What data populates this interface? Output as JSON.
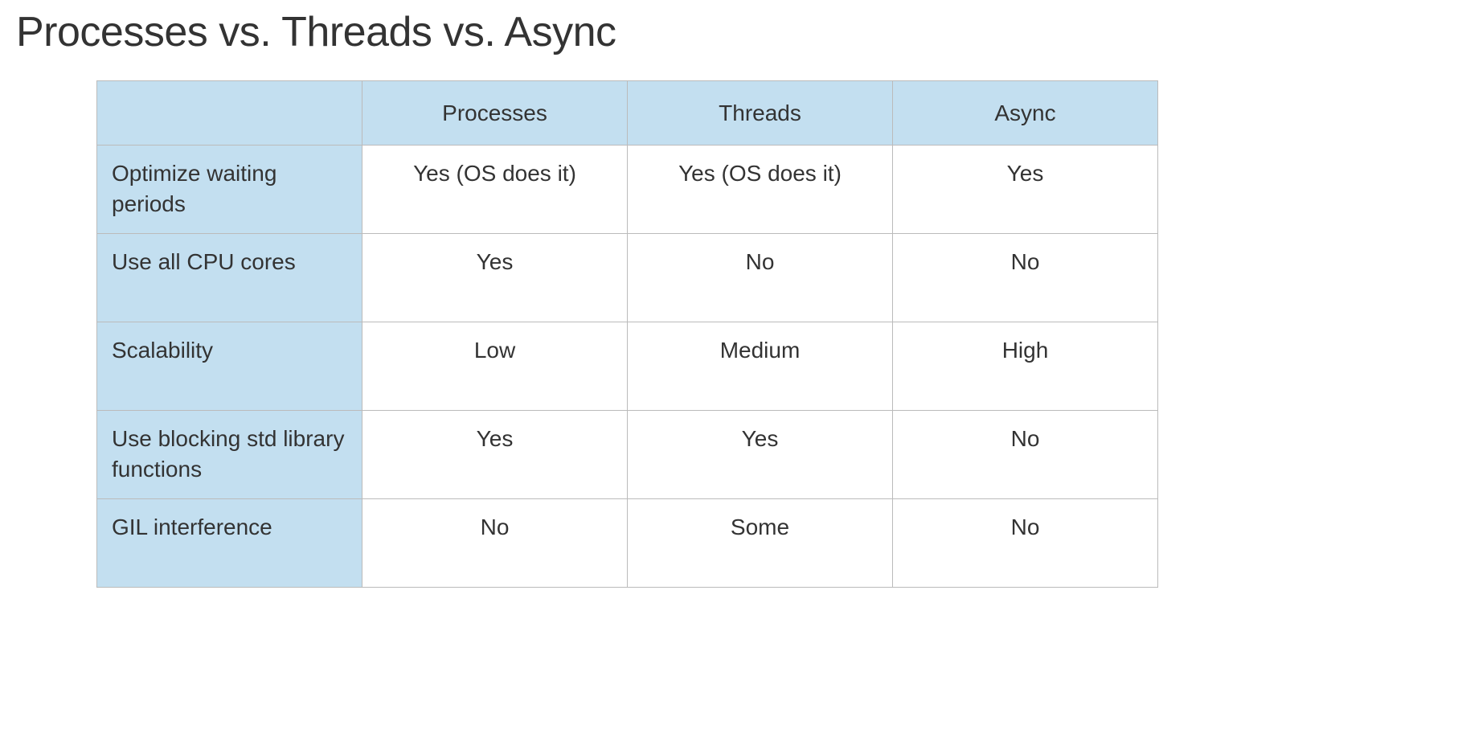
{
  "title": "Processes vs. Threads vs. Async",
  "columns": [
    "Processes",
    "Threads",
    "Async"
  ],
  "rows": [
    {
      "label": "Optimize waiting periods",
      "cells": [
        "Yes (OS does it)",
        "Yes (OS does it)",
        "Yes"
      ]
    },
    {
      "label": "Use all CPU cores",
      "cells": [
        "Yes",
        "No",
        "No"
      ]
    },
    {
      "label": "Scalability",
      "cells": [
        "Low",
        "Medium",
        "High"
      ]
    },
    {
      "label": "Use blocking std library functions",
      "cells": [
        "Yes",
        "Yes",
        "No"
      ]
    },
    {
      "label": "GIL interference",
      "cells": [
        "No",
        "Some",
        "No"
      ]
    }
  ],
  "chart_data": {
    "type": "table",
    "title": "Processes vs. Threads vs. Async",
    "columns": [
      "",
      "Processes",
      "Threads",
      "Async"
    ],
    "rows": [
      [
        "Optimize waiting periods",
        "Yes (OS does it)",
        "Yes (OS does it)",
        "Yes"
      ],
      [
        "Use all CPU cores",
        "Yes",
        "No",
        "No"
      ],
      [
        "Scalability",
        "Low",
        "Medium",
        "High"
      ],
      [
        "Use blocking std library functions",
        "Yes",
        "Yes",
        "No"
      ],
      [
        "GIL interference",
        "No",
        "Some",
        "No"
      ]
    ]
  }
}
